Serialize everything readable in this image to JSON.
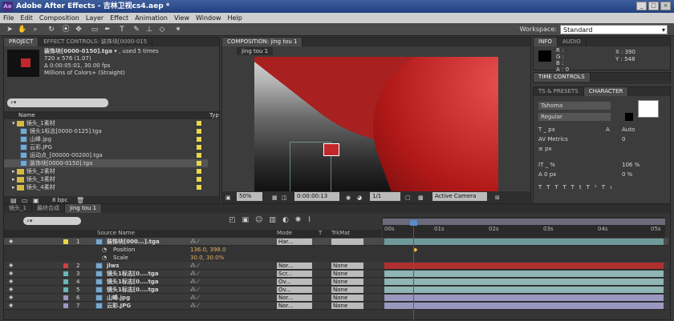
{
  "window": {
    "title": "Adobe After Effects - 吉林卫视cs4.aep *",
    "app_badge": "Ae",
    "min": "_",
    "max": "□",
    "close": "×"
  },
  "menu": [
    "File",
    "Edit",
    "Composition",
    "Layer",
    "Effect",
    "Animation",
    "View",
    "Window",
    "Help"
  ],
  "workspace": {
    "label": "Workspace:",
    "value": "Standard"
  },
  "project": {
    "tab_project": "PROJECT",
    "tab_effects": "EFFECT CONTROLS: 装饰块[0000-015",
    "asset_name": "装饰块[0000-0150].tga",
    "used": ", used 5 times",
    "info": [
      "720 x 576 (1.07)",
      "Δ 0:00:05:01, 30.00 fps",
      "Millions of Colors+ (Straight)"
    ],
    "search_placeholder": "",
    "col_name": "Name",
    "col_type": "Typ",
    "bpc": "8 bpc",
    "items": [
      {
        "name": "镜头_1素材",
        "kind": "folder",
        "indent": 1
      },
      {
        "name": "镜头1标志[0000-0125].tga",
        "kind": "file",
        "indent": 2
      },
      {
        "name": "山峰.jpg",
        "kind": "file",
        "indent": 2
      },
      {
        "name": "云彩.JPG",
        "kind": "file",
        "indent": 2
      },
      {
        "name": "运动点_[00000-00200].tga",
        "kind": "file",
        "indent": 2
      },
      {
        "name": "装饰块[0000-0150].tga",
        "kind": "file",
        "indent": 2
      },
      {
        "name": "镜头_2素材",
        "kind": "folder",
        "indent": 1
      },
      {
        "name": "镜头_3素材",
        "kind": "folder",
        "indent": 1
      },
      {
        "name": "镜头_4素材",
        "kind": "folder",
        "indent": 1
      }
    ]
  },
  "composition": {
    "tab": "COMPOSITION: jing tou 1",
    "subtab": "jing tou 1",
    "zoom": "50%",
    "timecode": "0:00:00:13",
    "resolution": "1/1",
    "camera": "Active Camera"
  },
  "info_panel": {
    "tab_info": "INFO",
    "tab_audio": "AUDIO",
    "r": "R :",
    "g": "G :",
    "b": "B :",
    "a": "A : 0",
    "x": "X : 390",
    "y": "Y : 548"
  },
  "time_controls": {
    "tab": "TIME CONTROLS"
  },
  "character": {
    "tab_ts": "TS & PRESETS",
    "tab_char": "CHARACTER",
    "font": "Tahoma",
    "style": "Regular",
    "size": "_ px",
    "leading": "Auto",
    "kerning": "Metrics",
    "tracking": "0",
    "stroke": "px",
    "vscale": "_ %",
    "hscale": "106 %",
    "baseline": "0 px",
    "tsume": "0 %"
  },
  "timeline": {
    "tabs": [
      "镜头_1",
      "最终合成",
      "jing tou 1"
    ],
    "search_placeholder": "",
    "col_source": "Source Name",
    "col_mode": "Mode",
    "col_t": "T",
    "col_trkmat": "TrkMat",
    "ruler": [
      "00s",
      "01s",
      "02s",
      "03s",
      "04s",
      "05s"
    ],
    "position_label": "Position",
    "position_value": "136.0, 398.0",
    "scale_label": "Scale",
    "scale_value": "30.0, 30.0%",
    "layers": [
      {
        "num": "1",
        "name": "装饰块[000...].tga",
        "mode": "Har...",
        "trk": "",
        "color": "#6f9a9a",
        "label": "#e8d84a"
      },
      {
        "num": "2",
        "name": "jlws",
        "mode": "Nor...",
        "trk": "None",
        "color": "#b03030",
        "label": "#d04040"
      },
      {
        "num": "3",
        "name": "镜头1标志[0....tga",
        "mode": "Scr...",
        "trk": "None",
        "color": "#8fb5b5",
        "label": "#6ab7b7"
      },
      {
        "num": "4",
        "name": "镜头1标志[0....tga",
        "mode": "Ov...",
        "trk": "None",
        "color": "#8fb5b5",
        "label": "#6ab7b7"
      },
      {
        "num": "5",
        "name": "镜头1标志[0....tga",
        "mode": "Ov...",
        "trk": "None",
        "color": "#8fb5b5",
        "label": "#6ab7b7"
      },
      {
        "num": "6",
        "name": "山峰.jpg",
        "mode": "Nor...",
        "trk": "None",
        "color": "#9a98c0",
        "label": "#9a98c0"
      },
      {
        "num": "7",
        "name": "云彩.JPG",
        "mode": "Nor...",
        "trk": "None",
        "color": "#9a98c0",
        "label": "#9a98c0"
      }
    ]
  },
  "colors": {
    "accent_red": "#c0282b",
    "panel": "#3c3c3c",
    "title_blue": "#2a4a8a"
  }
}
